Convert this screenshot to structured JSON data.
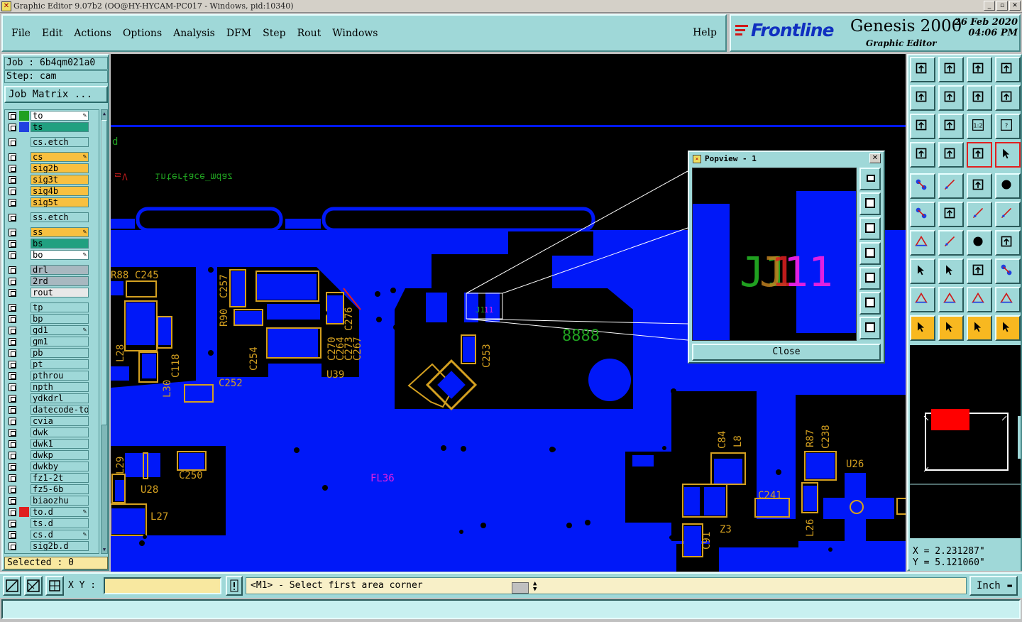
{
  "window": {
    "title": "Graphic Editor 9.07b2 (OO@HY-HYCAM-PC017 - Windows, pid:10340)",
    "controls": [
      "_",
      "▫",
      "✕"
    ]
  },
  "menu": {
    "items": [
      "File",
      "Edit",
      "Actions",
      "Options",
      "Analysis",
      "DFM",
      "Step",
      "Rout",
      "Windows"
    ],
    "help": "Help"
  },
  "brand": {
    "logo": "Frontline",
    "product": "Genesis 2000",
    "subtitle": "Graphic Editor",
    "date": "26 Feb 2020",
    "time": "04:06 PM"
  },
  "job": {
    "job_line": "Job : 6b4qm021a0",
    "step_line": "Step: cam",
    "matrix_button": "Job Matrix ..."
  },
  "layers": [
    {
      "name": "to",
      "color": "#ffffff",
      "swatch": "#20a020",
      "pen": true,
      "gap": false
    },
    {
      "name": "ts",
      "color": "#20a080",
      "swatch": "#2040e0",
      "pen": false,
      "gap": false
    },
    {
      "name": "cs.etch",
      "color": "#9fd8d8",
      "swatch": "",
      "pen": false,
      "gap": true
    },
    {
      "name": "cs",
      "color": "#f8c040",
      "swatch": "",
      "pen": true,
      "gap": true
    },
    {
      "name": "sig2b",
      "color": "#f8c040",
      "swatch": "",
      "pen": false,
      "gap": false
    },
    {
      "name": "sig3t",
      "color": "#f8c040",
      "swatch": "",
      "pen": false,
      "gap": false
    },
    {
      "name": "sig4b",
      "color": "#f8c040",
      "swatch": "",
      "pen": false,
      "gap": false
    },
    {
      "name": "sig5t",
      "color": "#f8c040",
      "swatch": "",
      "pen": false,
      "gap": false
    },
    {
      "name": "ss.etch",
      "color": "#9fd8d8",
      "swatch": "",
      "pen": false,
      "gap": true
    },
    {
      "name": "ss",
      "color": "#f8c040",
      "swatch": "",
      "pen": true,
      "gap": true
    },
    {
      "name": "bs",
      "color": "#20a080",
      "swatch": "",
      "pen": false,
      "gap": false
    },
    {
      "name": "bo",
      "color": "#ffffff",
      "swatch": "",
      "pen": true,
      "gap": false
    },
    {
      "name": "drl",
      "color": "#a8b8c0",
      "swatch": "",
      "pen": false,
      "gap": true
    },
    {
      "name": "2rd",
      "color": "#a8b8c0",
      "swatch": "",
      "pen": false,
      "gap": false
    },
    {
      "name": "rout",
      "color": "#e8e8e8",
      "swatch": "",
      "pen": false,
      "gap": false
    },
    {
      "name": "tp",
      "color": "#9fd8d8",
      "swatch": "",
      "pen": false,
      "gap": true
    },
    {
      "name": "bp",
      "color": "#9fd8d8",
      "swatch": "",
      "pen": false,
      "gap": false
    },
    {
      "name": "gd1",
      "color": "#9fd8d8",
      "swatch": "",
      "pen": true,
      "gap": false
    },
    {
      "name": "gm1",
      "color": "#9fd8d8",
      "swatch": "",
      "pen": false,
      "gap": false
    },
    {
      "name": "pb",
      "color": "#9fd8d8",
      "swatch": "",
      "pen": false,
      "gap": false
    },
    {
      "name": "pt",
      "color": "#9fd8d8",
      "swatch": "",
      "pen": false,
      "gap": false
    },
    {
      "name": "pthrou",
      "color": "#9fd8d8",
      "swatch": "",
      "pen": false,
      "gap": false
    },
    {
      "name": "npth",
      "color": "#9fd8d8",
      "swatch": "",
      "pen": false,
      "gap": false
    },
    {
      "name": "ydkdrl",
      "color": "#9fd8d8",
      "swatch": "",
      "pen": false,
      "gap": false
    },
    {
      "name": "datecode-to",
      "color": "#9fd8d8",
      "swatch": "",
      "pen": false,
      "gap": false
    },
    {
      "name": "cvia",
      "color": "#9fd8d8",
      "swatch": "",
      "pen": false,
      "gap": false
    },
    {
      "name": "dwk",
      "color": "#9fd8d8",
      "swatch": "",
      "pen": false,
      "gap": false
    },
    {
      "name": "dwk1",
      "color": "#9fd8d8",
      "swatch": "",
      "pen": false,
      "gap": false
    },
    {
      "name": "dwkp",
      "color": "#9fd8d8",
      "swatch": "",
      "pen": false,
      "gap": false
    },
    {
      "name": "dwkby",
      "color": "#9fd8d8",
      "swatch": "",
      "pen": false,
      "gap": false
    },
    {
      "name": "fz1-2t",
      "color": "#9fd8d8",
      "swatch": "",
      "pen": false,
      "gap": false
    },
    {
      "name": "fz5-6b",
      "color": "#9fd8d8",
      "swatch": "",
      "pen": false,
      "gap": false
    },
    {
      "name": "biaozhu",
      "color": "#9fd8d8",
      "swatch": "",
      "pen": false,
      "gap": false
    },
    {
      "name": "to.d",
      "color": "#9fd8d8",
      "swatch": "#e02020",
      "pen": true,
      "gap": false
    },
    {
      "name": "ts.d",
      "color": "#9fd8d8",
      "swatch": "",
      "pen": false,
      "gap": false
    },
    {
      "name": "cs.d",
      "color": "#9fd8d8",
      "swatch": "",
      "pen": true,
      "gap": false
    },
    {
      "name": "sig2b.d",
      "color": "#9fd8d8",
      "swatch": "",
      "pen": false,
      "gap": false
    }
  ],
  "selected": "Selected : 0",
  "canvas": {
    "labels": [
      {
        "text": "R88",
        "color": "#d4a020"
      },
      {
        "text": "C245",
        "color": "#d4a020"
      },
      {
        "text": "C257",
        "color": "#d4a020"
      },
      {
        "text": "R90",
        "color": "#d4a020"
      },
      {
        "text": "C276",
        "color": "#d4a020"
      },
      {
        "text": "C270",
        "color": "#d4a020"
      },
      {
        "text": "C264",
        "color": "#d4a020"
      },
      {
        "text": "C273",
        "color": "#d4a020"
      },
      {
        "text": "C267",
        "color": "#d4a020"
      },
      {
        "text": "C254",
        "color": "#d4a020"
      },
      {
        "text": "U39",
        "color": "#d4a020"
      },
      {
        "text": "C252",
        "color": "#d4a020"
      },
      {
        "text": "L28",
        "color": "#d4a020"
      },
      {
        "text": "L30",
        "color": "#d4a020"
      },
      {
        "text": "C118",
        "color": "#d4a020"
      },
      {
        "text": "C253",
        "color": "#d4a020"
      },
      {
        "text": "L29",
        "color": "#d4a020"
      },
      {
        "text": "U28",
        "color": "#d4a020"
      },
      {
        "text": "C250",
        "color": "#d4a020"
      },
      {
        "text": "L27",
        "color": "#d4a020"
      },
      {
        "text": "FL36",
        "color": "#e020e0"
      },
      {
        "text": "C84",
        "color": "#d4a020"
      },
      {
        "text": "L8",
        "color": "#d4a020"
      },
      {
        "text": "R87",
        "color": "#d4a020"
      },
      {
        "text": "C238",
        "color": "#d4a020"
      },
      {
        "text": "U26",
        "color": "#d4a020"
      },
      {
        "text": "C241",
        "color": "#d4a020"
      },
      {
        "text": "Z3",
        "color": "#d4a020"
      },
      {
        "text": "L26",
        "color": "#d4a020"
      },
      {
        "text": "C91",
        "color": "#d4a020"
      },
      {
        "text": "d",
        "color": "#20a020"
      },
      {
        "text": "8888",
        "color": "#20a020"
      },
      {
        "text": "J1",
        "color": "#20a020"
      },
      {
        "text": "11",
        "color": "#e020e0"
      }
    ]
  },
  "popview": {
    "title": "Popview - 1",
    "close_x": "✕",
    "close_button": "Close",
    "label_green": "J1",
    "label_orange": "J",
    "label_red": "1",
    "label_magenta": "11",
    "tools": [
      "zoom-in",
      "zoom-out",
      "fit",
      "pan-left",
      "pan-right",
      "fit-all",
      "fit-screen"
    ]
  },
  "toolbox": {
    "top_icons": [
      "open-job-icon",
      "save-job-icon",
      "home-icon",
      "window-split-icon",
      "import-icon",
      "export-icon",
      "undo-icon",
      "measure-icon",
      "fit-screen-icon",
      "center-icon",
      "scale-1-2-icon",
      "help-icon",
      "settings-icon",
      "snap-icon",
      "layer-toggle-icon",
      "layer-select-icon"
    ],
    "top_icon_text": {
      "scale-1-2-icon": "1:2",
      "help-icon": "?"
    },
    "draw_icons": [
      "add-pad-icon",
      "draw-line-icon",
      "ruler-icon",
      "circle-icon",
      "connect-icon",
      "delete-icon",
      "move-icon",
      "copy-icon",
      "angle-icon",
      "slope-icon",
      "rotate-icon",
      "mirror-icon",
      "pad-select-icon",
      "line-select-icon",
      "resize-icon",
      "group-icon",
      "triangle-icon",
      "arch-icon",
      "arch-bar-icon",
      "arch-pair-icon",
      "pointer-icon",
      "select-box-icon",
      "select-arrow-icon",
      "path-select-icon"
    ],
    "active": [
      "pointer-icon",
      "select-box-icon",
      "select-arrow-icon",
      "path-select-icon"
    ]
  },
  "coords": {
    "x": "X = 2.231287\"",
    "y": "Y = 5.121060\""
  },
  "status": {
    "xy_label": "X Y :",
    "xy_value": "",
    "prompt": "<M1> - Select first area corner",
    "unit": "Inch"
  },
  "colors": {
    "panel": "#9fd8d8",
    "copper": "#0018f8",
    "silk": "#d4a020",
    "background": "#000000"
  }
}
